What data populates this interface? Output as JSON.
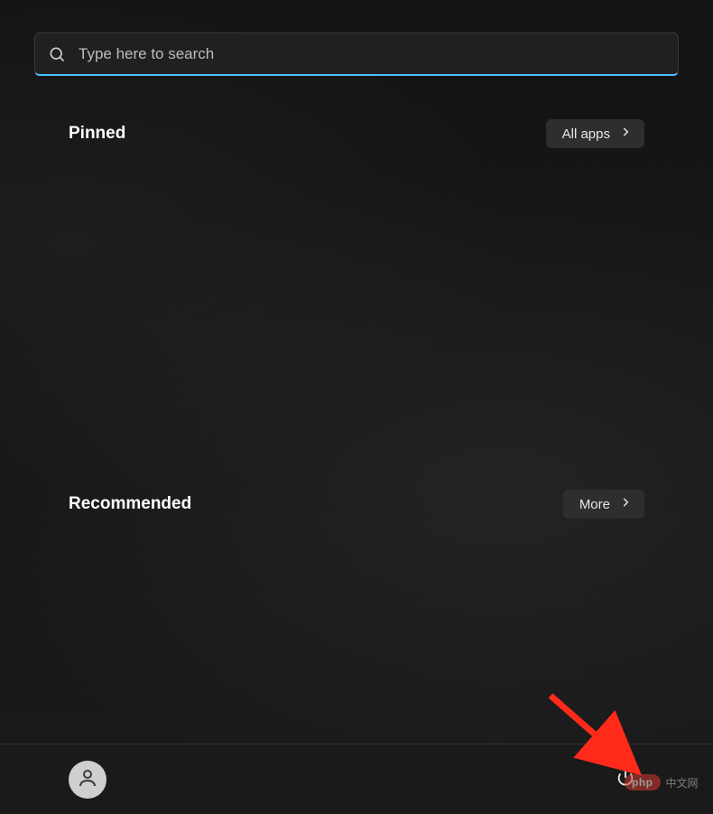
{
  "search": {
    "placeholder": "Type here to search",
    "value": ""
  },
  "sections": {
    "pinned": {
      "title": "Pinned",
      "button_label": "All apps"
    },
    "recommended": {
      "title": "Recommended",
      "button_label": "More"
    }
  },
  "footer": {
    "user_icon": "person-icon",
    "power_icon": "power-icon"
  },
  "watermark": {
    "brand": "php",
    "text": "中文网"
  },
  "colors": {
    "accent": "#4cc2ff",
    "arrow": "#ff2a1a",
    "panel_bg": "#1a1a1a",
    "pill_bg": "#2e2e2e"
  }
}
